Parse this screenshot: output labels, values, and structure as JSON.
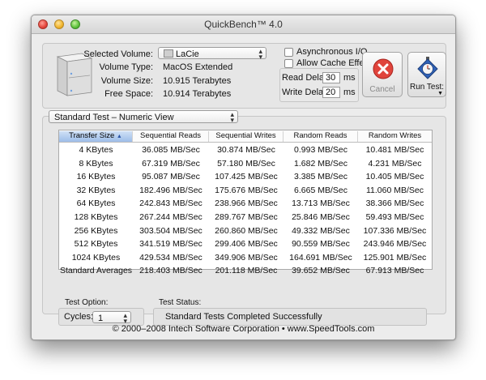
{
  "window": {
    "title": "QuickBench™ 4.0"
  },
  "volume": {
    "selected_label": "Selected Volume:",
    "selected_value": "LaCie",
    "type_label": "Volume Type:",
    "type_value": "MacOS Extended",
    "size_label": "Volume Size:",
    "size_value": "10.915 Terabytes",
    "free_label": "Free Space:",
    "free_value": "10.914 Terabytes"
  },
  "options": {
    "async_io": "Asynchronous I/O",
    "allow_cache": "Allow Cache Effects",
    "async_checked": false,
    "cache_checked": false
  },
  "delay": {
    "read_label": "Read Delay:",
    "read_value": "30",
    "write_label": "Write Delay:",
    "write_value": "20",
    "unit": "ms"
  },
  "buttons": {
    "cancel": "Cancel",
    "run": "Run Test:"
  },
  "view": {
    "selected": "Standard Test – Numeric View"
  },
  "table": {
    "headers": [
      "Transfer Size",
      "Sequential Reads",
      "Sequential Writes",
      "Random Reads",
      "Random Writes"
    ],
    "rows": [
      [
        "4 KBytes",
        "36.085 MB/Sec",
        "30.874 MB/Sec",
        "0.993 MB/Sec",
        "10.481 MB/Sec"
      ],
      [
        "8 KBytes",
        "67.319 MB/Sec",
        "57.180 MB/Sec",
        "1.682 MB/Sec",
        "4.231 MB/Sec"
      ],
      [
        "16 KBytes",
        "95.087 MB/Sec",
        "107.425 MB/Sec",
        "3.385 MB/Sec",
        "10.405 MB/Sec"
      ],
      [
        "32 KBytes",
        "182.496 MB/Sec",
        "175.676 MB/Sec",
        "6.665 MB/Sec",
        "11.060 MB/Sec"
      ],
      [
        "64 KBytes",
        "242.843 MB/Sec",
        "238.966 MB/Sec",
        "13.713 MB/Sec",
        "38.366 MB/Sec"
      ],
      [
        "128 KBytes",
        "267.244 MB/Sec",
        "289.767 MB/Sec",
        "25.846 MB/Sec",
        "59.493 MB/Sec"
      ],
      [
        "256 KBytes",
        "303.504 MB/Sec",
        "260.860 MB/Sec",
        "49.332 MB/Sec",
        "107.336 MB/Sec"
      ],
      [
        "512 KBytes",
        "341.519 MB/Sec",
        "299.406 MB/Sec",
        "90.559 MB/Sec",
        "243.946 MB/Sec"
      ],
      [
        "1024 KBytes",
        "429.534 MB/Sec",
        "349.906 MB/Sec",
        "164.691 MB/Sec",
        "125.901 MB/Sec"
      ],
      [
        "Standard Averages",
        "218.403 MB/Sec",
        "201.118 MB/Sec",
        "39.652 MB/Sec",
        "67.913 MB/Sec"
      ]
    ]
  },
  "test_option": {
    "label": "Test Option:",
    "cycles_label": "Cycles:",
    "cycles_value": "1"
  },
  "test_status": {
    "label": "Test Status:",
    "value": "Standard Tests Completed Successfully"
  },
  "footer": "© 2000–2008 Intech Software Corporation • www.SpeedTools.com",
  "colors": {
    "header_selected": "#9dbde9",
    "cancel_red": "#e0443c",
    "run_blue": "#2f62b8"
  }
}
